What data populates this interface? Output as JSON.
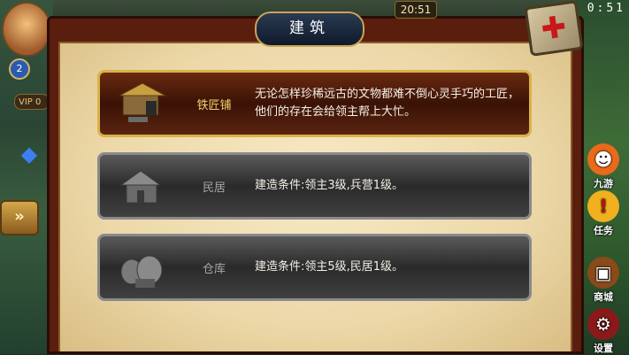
{
  "status_bar": {
    "time_left": "20:51",
    "time_right": "0:51"
  },
  "hud_left": {
    "level": "2",
    "vip": "VIP 0"
  },
  "hud_right": [
    {
      "label": "九游",
      "icon": "nine-game-icon"
    },
    {
      "label": "任务",
      "icon": "exclamation-icon"
    },
    {
      "label": "商城",
      "icon": "shop-icon"
    },
    {
      "label": "设置",
      "icon": "settings-icon"
    }
  ],
  "dialog": {
    "title": "建筑",
    "items": [
      {
        "name": "铁匠铺",
        "desc": "无论怎样珍稀远古的文物都难不倒心灵手巧的工匠，他们的存在会给领主帮上大忙。",
        "state": "unlocked"
      },
      {
        "name": "民居",
        "desc": "建造条件:领主3级,兵营1级。",
        "state": "locked"
      },
      {
        "name": "仓库",
        "desc": "建造条件:领主5级,民居1级。",
        "state": "locked"
      }
    ]
  },
  "colors": {
    "frame": "#5a1e0e",
    "parchment": "#f2e2b8",
    "gold": "#d8b24a",
    "close_red": "#c81818"
  }
}
